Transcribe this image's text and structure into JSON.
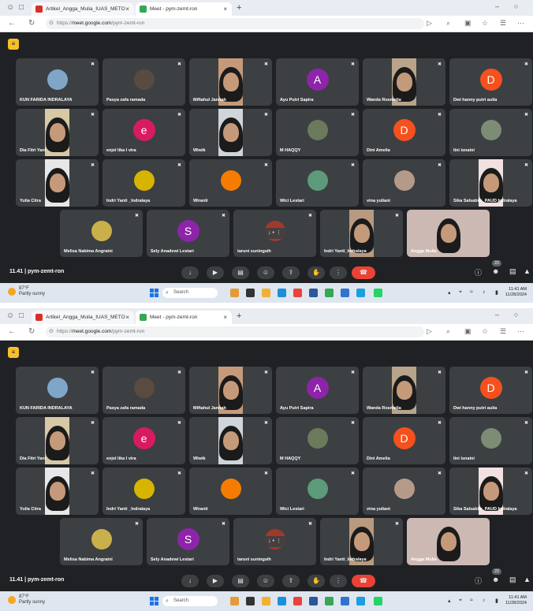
{
  "browser": {
    "tabs": [
      {
        "label": "Artikel_Angga_Mulia_IUAS_METO",
        "fav_color": "#d93025"
      },
      {
        "label": "Meet - pym-zemt-ron",
        "fav_color": "#34a853"
      }
    ],
    "url_prefix": "https://",
    "url_host": "meet.google.com",
    "url_path": "/pym-zemt-ron"
  },
  "meet": {
    "meeting_time": "11.41",
    "meeting_code": "pym-zemt-ron",
    "participant_count": "23",
    "participants": [
      {
        "name": "KUN FARIDA INDRALAYA",
        "kind": "photo",
        "color": "#7fa6c9"
      },
      {
        "name": "Pasya zafa ramada",
        "kind": "photo",
        "color": "#5a4a40"
      },
      {
        "name": "Miftahul Jannah",
        "kind": "video",
        "color": "#c59a7a"
      },
      {
        "name": "Ayu Putri Sapira",
        "kind": "letter",
        "letter": "A",
        "color": "#8e24aa"
      },
      {
        "name": "Wanda Rosmelia",
        "kind": "video",
        "color": "#b7a48a"
      },
      {
        "name": "Dwi hanny putri aulia",
        "kind": "letter",
        "letter": "D",
        "color": "#f4511e"
      },
      {
        "name": "Dia Fitri Yani",
        "kind": "video",
        "color": "#d7c8a6"
      },
      {
        "name": "enjel lika I vira",
        "kind": "letter",
        "letter": "e",
        "color": "#d81b60"
      },
      {
        "name": "Wiwik",
        "kind": "video",
        "color": "#cfd5da"
      },
      {
        "name": "M HAQQY",
        "kind": "photo",
        "color": "#6b7a5a"
      },
      {
        "name": "Dini Amelia",
        "kind": "letter",
        "letter": "D",
        "color": "#f4511e"
      },
      {
        "name": "lini isnaini",
        "kind": "photo",
        "color": "#7d8c74"
      },
      {
        "name": "Yulia Citra",
        "kind": "video",
        "color": "#e7e7e7"
      },
      {
        "name": "Indri Yanti _Indralaya",
        "kind": "photo",
        "color": "#d7b400"
      },
      {
        "name": "Wiranti",
        "kind": "photo",
        "color": "#f57c00"
      },
      {
        "name": "Wici Lestari",
        "kind": "photo",
        "color": "#5d9a7a"
      },
      {
        "name": "vina yuliani",
        "kind": "photo",
        "color": "#b59a8a"
      },
      {
        "name": "Sika Salsabila_PAUD Indralaya",
        "kind": "video",
        "color": "#f1e1e1"
      },
      {
        "name": "Melisa Nabima Angraini",
        "kind": "photo",
        "color": "#c9b04a"
      },
      {
        "name": "Sely Anadewi Lestari",
        "kind": "letter",
        "letter": "S",
        "color": "#8e24aa"
      },
      {
        "name": "taruni suningsih",
        "kind": "photo",
        "color": "#a0392b"
      },
      {
        "name": "Indri Yanti_Indralaya",
        "kind": "video",
        "color": "#b89a80"
      },
      {
        "name": "Angga Mulia",
        "kind": "self",
        "color": "#cdb9b4"
      }
    ]
  },
  "taskbar": {
    "weather_temp": "87°F",
    "weather_desc": "Partly sunny",
    "search_placeholder": "Search",
    "time": "11:41 AM",
    "date": "11/28/2024"
  }
}
